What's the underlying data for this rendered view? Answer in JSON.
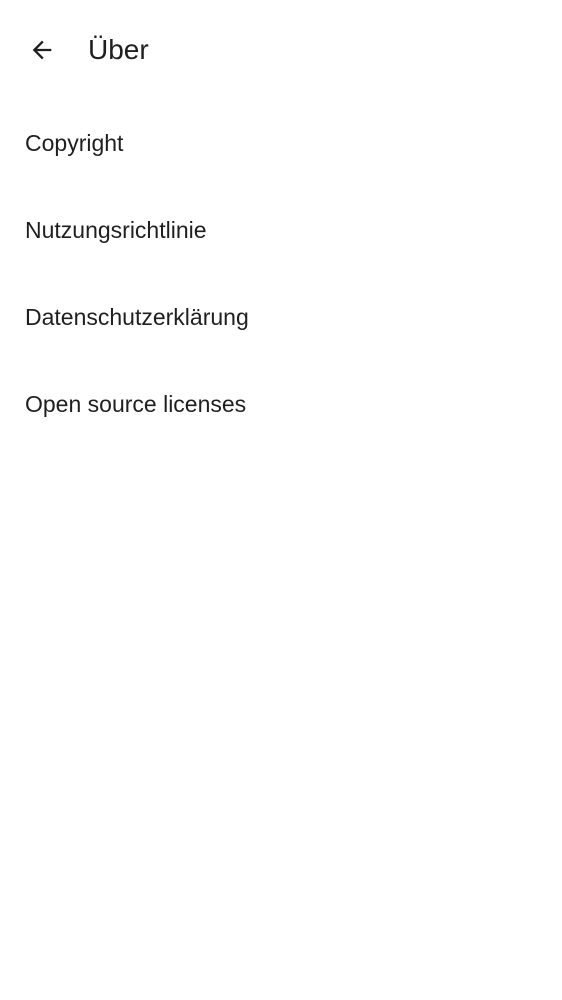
{
  "header": {
    "back_icon": "arrow-left-icon",
    "title": "Über"
  },
  "menu": {
    "items": [
      {
        "label": "Copyright"
      },
      {
        "label": "Nutzungsrichtlinie"
      },
      {
        "label": "Datenschutzerklärung"
      },
      {
        "label": "Open source licenses"
      }
    ]
  },
  "colors": {
    "background": "#ffffff",
    "text": "#1f1f1f"
  }
}
